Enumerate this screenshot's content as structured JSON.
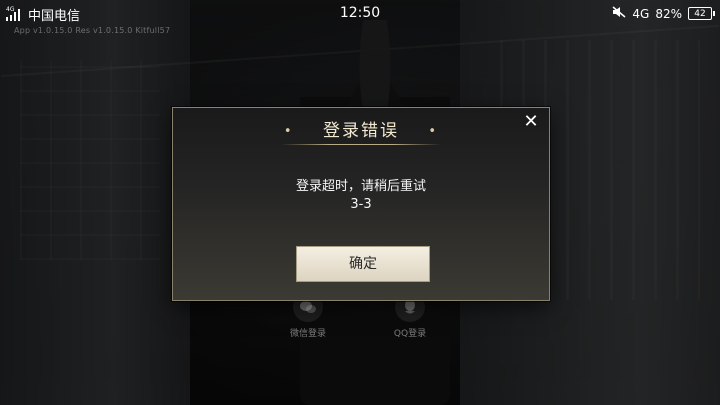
{
  "status_bar": {
    "carrier": "中国电信",
    "network_tag": "4G",
    "time": "12:50",
    "mobile_type": "4G",
    "battery_percent": "82%",
    "battery_icon_text": "42"
  },
  "app": {
    "version_text": "App v1.0.15.0 Res v1.0.15.0 Kitfull57"
  },
  "login_options": [
    {
      "label": "微信登录",
      "icon": "wechat-icon"
    },
    {
      "label": "QQ登录",
      "icon": "qq-icon"
    }
  ],
  "dialog": {
    "title": "登录错误",
    "title_decor": "•",
    "message_line1": "登录超时，请稍后重试",
    "message_line2": "3-3",
    "confirm_label": "确定",
    "close_symbol": "✕"
  },
  "colors": {
    "dialog_border": "#8a826c",
    "title_text": "#f3ead2",
    "button_bg": "#f4efe3"
  }
}
